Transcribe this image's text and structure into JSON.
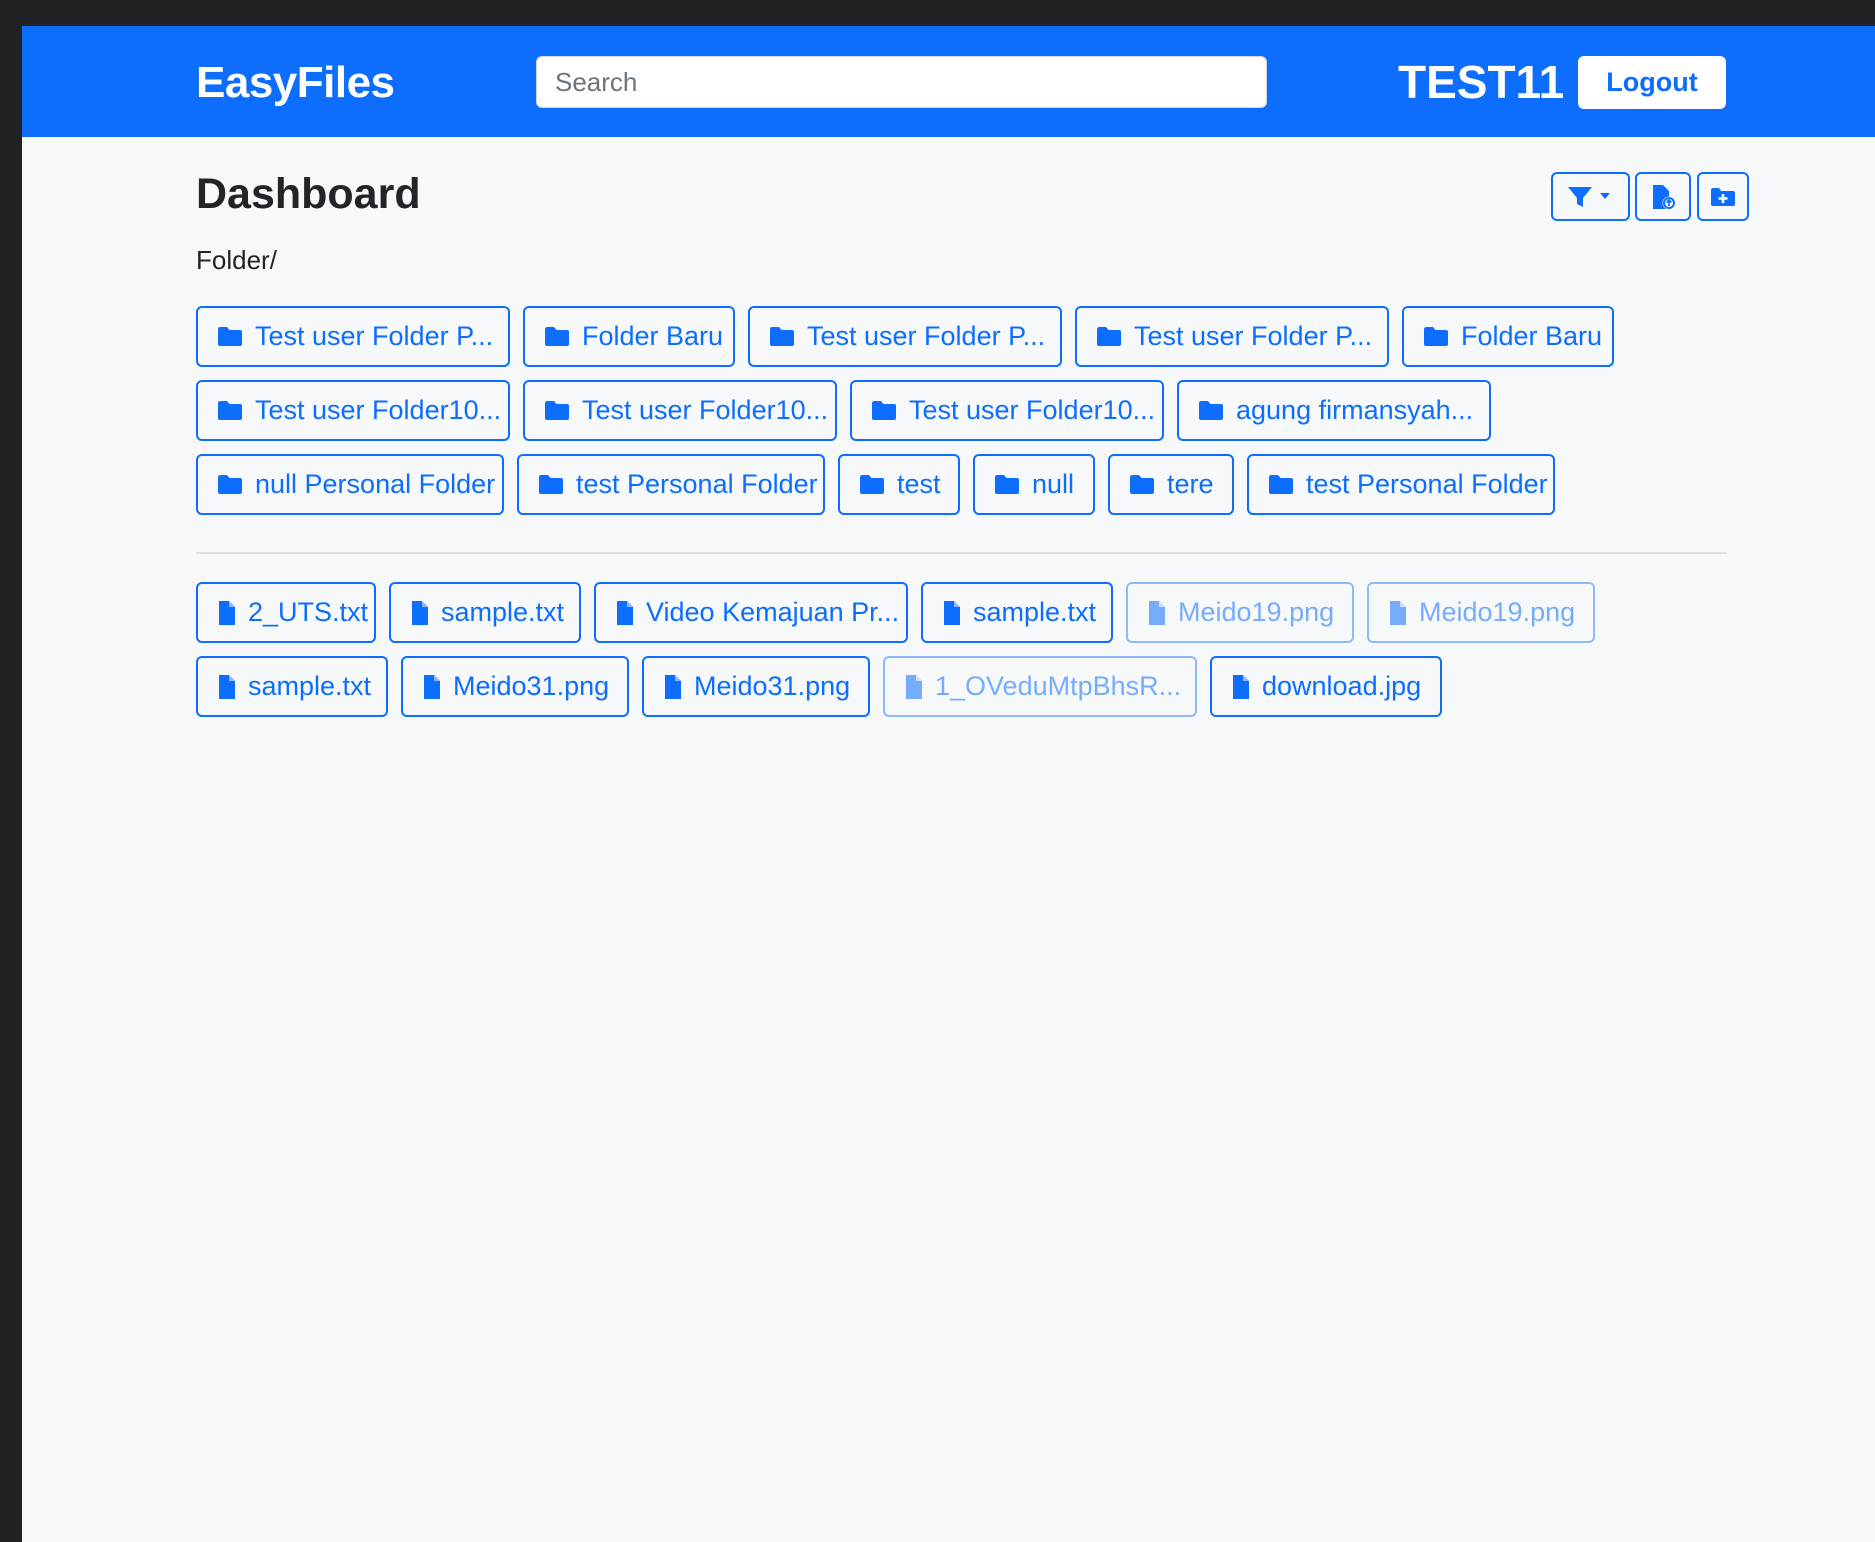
{
  "app": {
    "brand": "EasyFiles"
  },
  "header": {
    "search_placeholder": "Search",
    "username": "TEST11",
    "logout_label": "Logout"
  },
  "main": {
    "title": "Dashboard",
    "breadcrumb": "Folder/",
    "toolbar": {
      "filter_icon": "filter-dropdown-icon",
      "upload_icon": "file-upload-icon",
      "new_folder_icon": "folder-plus-icon"
    },
    "folders": [
      "Test user Folder P...",
      "Folder Baru",
      "Test user Folder P...",
      "Test user Folder P...",
      "Folder Baru",
      "Test user Folder10...",
      "Test user Folder10...",
      "Test user Folder10...",
      "agung firmansyah...",
      "null Personal Folder",
      "test Personal Folder",
      "test",
      "null",
      "tere",
      "test Personal Folder"
    ],
    "files": [
      "2_UTS.txt",
      "sample.txt",
      "Video Kemajuan Pr...",
      "sample.txt",
      "Meido19.png",
      "Meido19.png",
      "sample.txt",
      "Meido31.png",
      "Meido31.png",
      "1_OVeduMtpBhsR...",
      "download.jpg"
    ]
  },
  "colors": {
    "primary": "#0d6efd",
    "page_bg": "#f6f8fa",
    "text": "#212529"
  }
}
